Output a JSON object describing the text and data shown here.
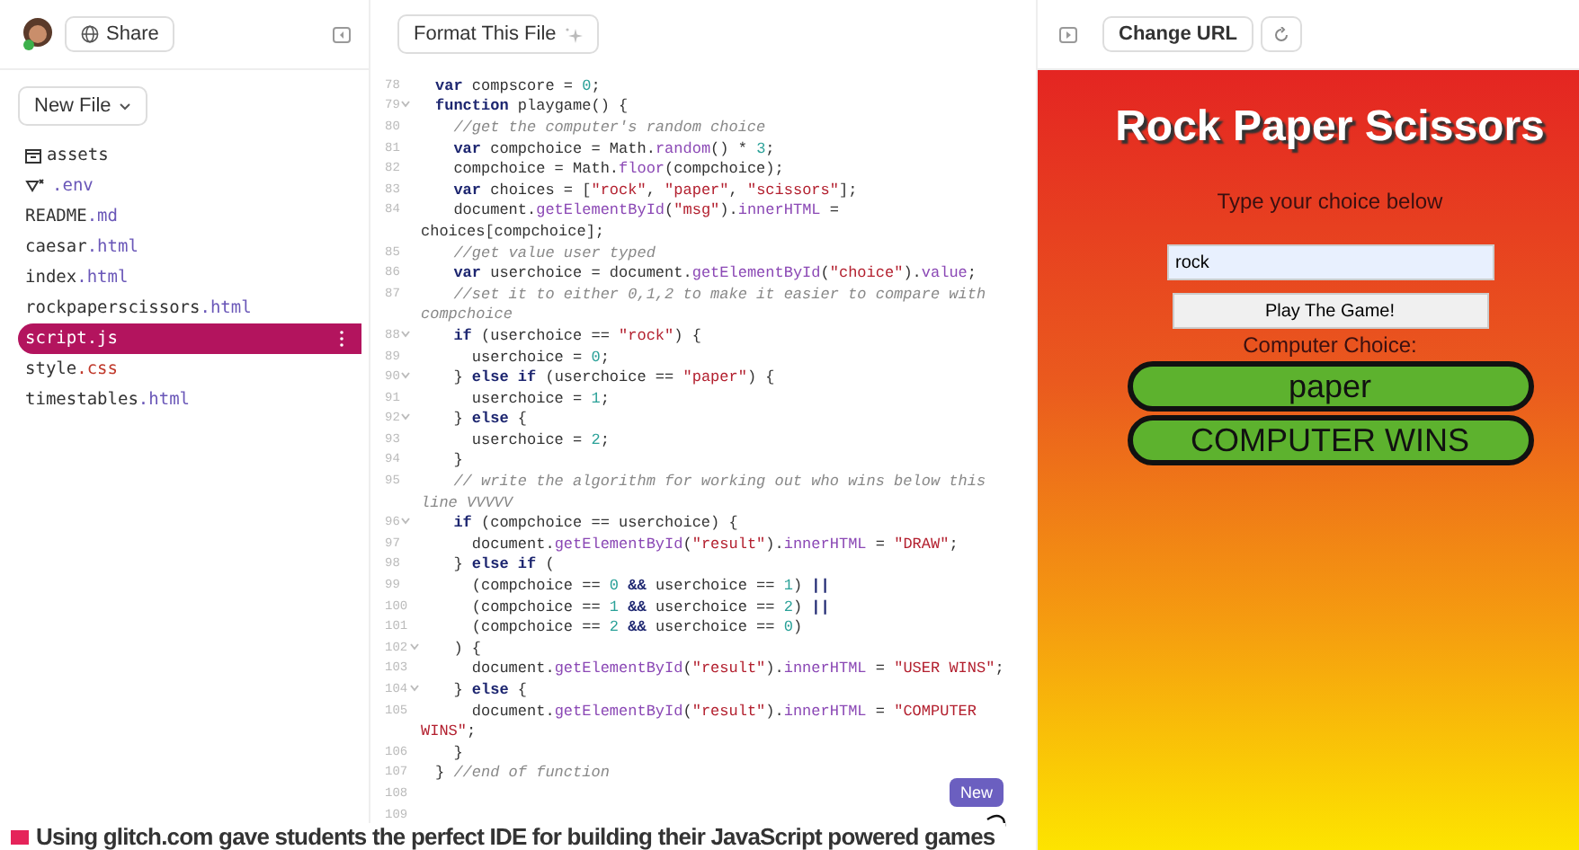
{
  "sidebar": {
    "share_label": "Share",
    "new_file_label": "New File",
    "files": [
      {
        "kind": "folder",
        "name": "assets",
        "selected": false
      },
      {
        "kind": "env",
        "ext": ".env",
        "selected": false
      },
      {
        "kind": "file",
        "name": "README",
        "ext": ".md",
        "selected": false
      },
      {
        "kind": "file",
        "name": "caesar",
        "ext": ".html",
        "selected": false
      },
      {
        "kind": "file",
        "name": "index",
        "ext": ".html",
        "selected": false
      },
      {
        "kind": "file",
        "name": "rockpaperscissors",
        "ext": ".html",
        "selected": false
      },
      {
        "kind": "file",
        "name": "script.js",
        "selected": true
      },
      {
        "kind": "file",
        "name": "style",
        "ext": ".css",
        "selected": false
      },
      {
        "kind": "file",
        "name": "timestables",
        "ext": ".html",
        "selected": false
      }
    ]
  },
  "editor": {
    "format_label": "Format This File",
    "badge": "New",
    "lines": [
      {
        "n": "78",
        "segs": [
          {
            "kind": "keyword",
            "t": "var"
          },
          {
            "t": " compscore = "
          },
          {
            "kind": "number",
            "t": "0"
          },
          {
            "t": ";"
          }
        ]
      },
      {
        "n": "79",
        "fold": true,
        "segs": [
          {
            "kind": "keyword",
            "t": "function"
          },
          {
            "t": " playgame() {"
          }
        ]
      },
      {
        "n": "80",
        "segs": [
          {
            "kind": "comment",
            "t": "  //get the computer's random choice"
          }
        ]
      },
      {
        "n": "81",
        "segs": [
          {
            "kind": "keyword",
            "t": "  var"
          },
          {
            "t": " compchoice = Math."
          },
          {
            "kind": "method",
            "t": "random"
          },
          {
            "t": "() * "
          },
          {
            "kind": "number",
            "t": "3"
          },
          {
            "t": ";"
          }
        ]
      },
      {
        "n": "82",
        "segs": [
          {
            "t": "  compchoice = Math."
          },
          {
            "kind": "method",
            "t": "floor"
          },
          {
            "t": "(compchoice);"
          }
        ]
      },
      {
        "n": "83",
        "segs": [
          {
            "kind": "keyword",
            "t": "  var"
          },
          {
            "t": " choices = ["
          },
          {
            "kind": "string",
            "t": "\"rock\""
          },
          {
            "t": ", "
          },
          {
            "kind": "string",
            "t": "\"paper\""
          },
          {
            "t": ", "
          },
          {
            "kind": "string",
            "t": "\"scissors\""
          },
          {
            "t": "];"
          }
        ]
      },
      {
        "n": "84",
        "segs": [
          {
            "t": "  document."
          },
          {
            "kind": "method",
            "t": "getElementById"
          },
          {
            "t": "("
          },
          {
            "kind": "string",
            "t": "\"msg\""
          },
          {
            "t": ")."
          },
          {
            "kind": "method",
            "t": "innerHTML"
          },
          {
            "t": " ="
          }
        ]
      },
      {
        "segs": [
          {
            "t": "choices[compchoice];"
          }
        ]
      },
      {
        "n": "85",
        "segs": [
          {
            "kind": "comment",
            "t": "  //get value user typed"
          }
        ]
      },
      {
        "n": "86",
        "segs": [
          {
            "kind": "keyword",
            "t": "  var"
          },
          {
            "t": " userchoice = document."
          },
          {
            "kind": "method",
            "t": "getElementById"
          },
          {
            "t": "("
          },
          {
            "kind": "string",
            "t": "\"choice\""
          },
          {
            "t": ")."
          },
          {
            "kind": "method",
            "t": "value"
          },
          {
            "t": ";"
          }
        ]
      },
      {
        "n": "87",
        "segs": [
          {
            "kind": "comment",
            "t": "  //set it to either 0,1,2 to make it easier to compare with"
          }
        ]
      },
      {
        "segs": [
          {
            "kind": "comment",
            "t": "compchoice"
          }
        ]
      },
      {
        "n": "88",
        "fold": true,
        "segs": [
          {
            "kind": "keyword",
            "t": "  if"
          },
          {
            "t": " (userchoice == "
          },
          {
            "kind": "string",
            "t": "\"rock\""
          },
          {
            "t": ") {"
          }
        ]
      },
      {
        "n": "89",
        "segs": [
          {
            "t": "    userchoice = "
          },
          {
            "kind": "number",
            "t": "0"
          },
          {
            "t": ";"
          }
        ]
      },
      {
        "n": "90",
        "fold": true,
        "segs": [
          {
            "t": "  } "
          },
          {
            "kind": "keyword",
            "t": "else if"
          },
          {
            "t": " (userchoice == "
          },
          {
            "kind": "string",
            "t": "\"paper\""
          },
          {
            "t": ") {"
          }
        ]
      },
      {
        "n": "91",
        "segs": [
          {
            "t": "    userchoice = "
          },
          {
            "kind": "number",
            "t": "1"
          },
          {
            "t": ";"
          }
        ]
      },
      {
        "n": "92",
        "fold": true,
        "segs": [
          {
            "t": "  } "
          },
          {
            "kind": "keyword",
            "t": "else"
          },
          {
            "t": " {"
          }
        ]
      },
      {
        "n": "93",
        "segs": [
          {
            "t": "    userchoice = "
          },
          {
            "kind": "number",
            "t": "2"
          },
          {
            "t": ";"
          }
        ]
      },
      {
        "n": "94",
        "segs": [
          {
            "t": "  }"
          }
        ]
      },
      {
        "n": "95",
        "segs": [
          {
            "kind": "comment",
            "t": "  // write the algorithm for working out who wins below this"
          }
        ]
      },
      {
        "segs": [
          {
            "kind": "comment",
            "t": "line VVVVV"
          }
        ]
      },
      {
        "n": "96",
        "fold": true,
        "segs": [
          {
            "kind": "keyword",
            "t": "  if"
          },
          {
            "t": " (compchoice == userchoice) {"
          }
        ]
      },
      {
        "n": "97",
        "segs": [
          {
            "t": "    document."
          },
          {
            "kind": "method",
            "t": "getElementById"
          },
          {
            "t": "("
          },
          {
            "kind": "string",
            "t": "\"result\""
          },
          {
            "t": ")."
          },
          {
            "kind": "method",
            "t": "innerHTML"
          },
          {
            "t": " = "
          },
          {
            "kind": "string",
            "t": "\"DRAW\""
          },
          {
            "t": ";"
          }
        ]
      },
      {
        "n": "98",
        "segs": [
          {
            "t": "  } "
          },
          {
            "kind": "keyword",
            "t": "else if"
          },
          {
            "t": " ("
          }
        ]
      },
      {
        "n": "99",
        "segs": [
          {
            "t": "    (compchoice == "
          },
          {
            "kind": "number",
            "t": "0"
          },
          {
            "kind": "keyword",
            "t": " &&"
          },
          {
            "t": " userchoice == "
          },
          {
            "kind": "number",
            "t": "1"
          },
          {
            "t": ") "
          },
          {
            "kind": "keyword",
            "t": "||"
          }
        ]
      },
      {
        "n": "100",
        "segs": [
          {
            "t": "    (compchoice == "
          },
          {
            "kind": "number",
            "t": "1"
          },
          {
            "kind": "keyword",
            "t": " &&"
          },
          {
            "t": " userchoice == "
          },
          {
            "kind": "number",
            "t": "2"
          },
          {
            "t": ") "
          },
          {
            "kind": "keyword",
            "t": "||"
          }
        ]
      },
      {
        "n": "101",
        "segs": [
          {
            "t": "    (compchoice == "
          },
          {
            "kind": "number",
            "t": "2"
          },
          {
            "kind": "keyword",
            "t": " &&"
          },
          {
            "t": " userchoice == "
          },
          {
            "kind": "number",
            "t": "0"
          },
          {
            "t": ")"
          }
        ]
      },
      {
        "n": "102",
        "fold": true,
        "segs": [
          {
            "t": "  ) {"
          }
        ]
      },
      {
        "n": "103",
        "segs": [
          {
            "t": "    document."
          },
          {
            "kind": "method",
            "t": "getElementById"
          },
          {
            "t": "("
          },
          {
            "kind": "string",
            "t": "\"result\""
          },
          {
            "t": ")."
          },
          {
            "kind": "method",
            "t": "innerHTML"
          },
          {
            "t": " = "
          },
          {
            "kind": "string",
            "t": "\"USER WINS\""
          },
          {
            "t": ";"
          }
        ]
      },
      {
        "n": "104",
        "fold": true,
        "segs": [
          {
            "t": "  } "
          },
          {
            "kind": "keyword",
            "t": "else"
          },
          {
            "t": " {"
          }
        ]
      },
      {
        "n": "105",
        "segs": [
          {
            "t": "    document."
          },
          {
            "kind": "method",
            "t": "getElementById"
          },
          {
            "t": "("
          },
          {
            "kind": "string",
            "t": "\"result\""
          },
          {
            "t": ")."
          },
          {
            "kind": "method",
            "t": "innerHTML"
          },
          {
            "t": " = "
          },
          {
            "kind": "string",
            "t": "\"COMPUTER"
          }
        ]
      },
      {
        "segs": [
          {
            "kind": "string",
            "t": "WINS\""
          },
          {
            "t": ";"
          }
        ]
      },
      {
        "n": "106",
        "segs": [
          {
            "t": "  }"
          }
        ]
      },
      {
        "n": "107",
        "segs": [
          {
            "t": "} "
          },
          {
            "kind": "comment",
            "t": "//end of function"
          }
        ]
      },
      {
        "n": "108"
      },
      {
        "n": "109"
      }
    ]
  },
  "preview": {
    "change_url_label": "Change URL",
    "title": "Rock Paper Scissors",
    "prompt": "Type your choice below",
    "input_value": "rock",
    "play_label": "Play The Game!",
    "computer_label": "Computer Choice:",
    "computer_choice": "paper",
    "result": "COMPUTER WINS"
  },
  "caption": "Using glitch.com gave students the perfect IDE for building their JavaScript powered games"
}
